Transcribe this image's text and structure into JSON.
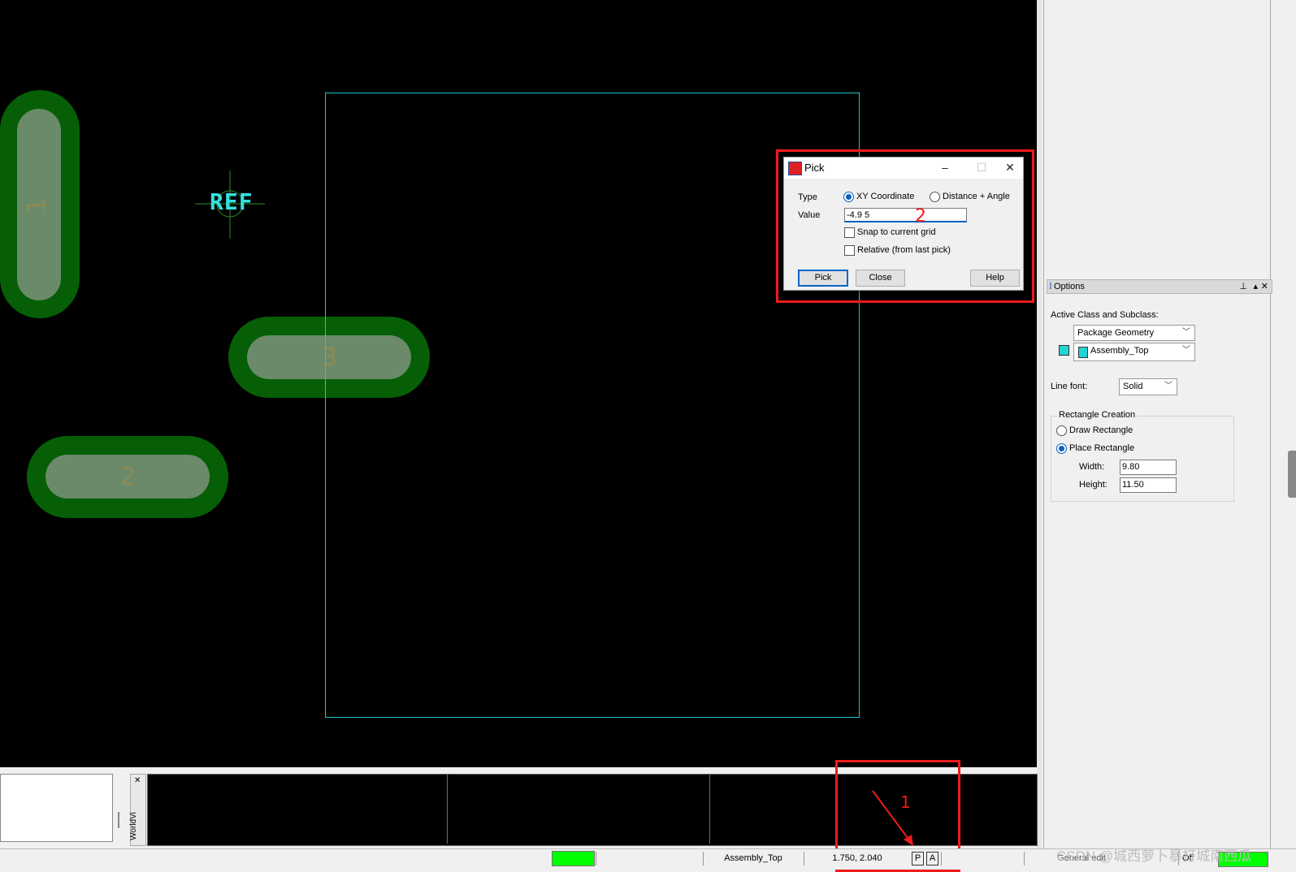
{
  "canvas": {
    "ref_label": "REF",
    "pads": [
      {
        "number": "1"
      },
      {
        "number": "3"
      },
      {
        "number": "2"
      }
    ]
  },
  "pick_dialog": {
    "title": "Pick",
    "type_label": "Type",
    "type_options": [
      "XY Coordinate",
      "Distance + Angle"
    ],
    "type_selected": "XY Coordinate",
    "value_label": "Value",
    "value": "-4.9 5",
    "snap_label": "Snap to current grid",
    "relative_label": "Relative (from last pick)",
    "buttons": {
      "pick": "Pick",
      "close": "Close",
      "help": "Help"
    },
    "controls": {
      "minimize": "–",
      "maximize": "☐",
      "close": "✕"
    }
  },
  "annotations": {
    "label_1": "1",
    "label_2": "2"
  },
  "options_panel": {
    "title": "Options",
    "active_class_label": "Active Class and Subclass:",
    "class_value": "Package Geometry",
    "subclass_value": "Assembly_Top",
    "line_font_label": "Line font:",
    "line_font_value": "Solid",
    "rect_group_label": "Rectangle Creation",
    "draw_rect_label": "Draw Rectangle",
    "place_rect_label": "Place Rectangle",
    "width_label": "Width:",
    "width_value": "9.80",
    "height_label": "Height:",
    "height_value": "11.50",
    "subclass_color": "#1fd5d5"
  },
  "worldview_label": "WorldVi",
  "status_bar": {
    "subclass": "Assembly_Top",
    "coordinates": "1.750, 2.040",
    "p_button": "P",
    "a_button": "A",
    "mode": "General edit",
    "other": "Off",
    "watermark": "CSDN @城西萝卜暴打城南西瓜"
  },
  "colors": {
    "canvas_bg": "#000000",
    "pad_outer": "#065f06",
    "pad_inner": "#6a8a6a",
    "outline": "#1fc7c7",
    "highlight_red": "#ee1b1b",
    "status_green": "#00ff00"
  }
}
